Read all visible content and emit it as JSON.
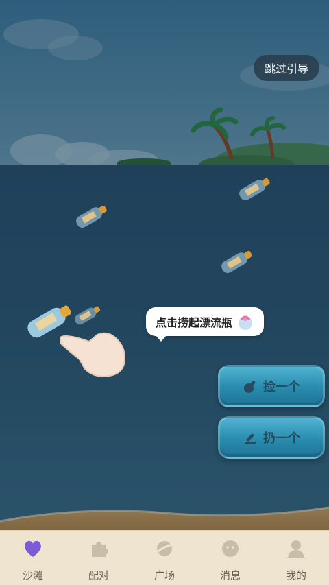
{
  "guide": {
    "skip_label": "跳过引导"
  },
  "tooltip": {
    "text": "点击捞起漂流瓶"
  },
  "actions": {
    "pick_label": "捡一个",
    "throw_label": "扔一个"
  },
  "tabs": [
    {
      "label": "沙滩",
      "icon": "heart-icon",
      "active": true
    },
    {
      "label": "配对",
      "icon": "puzzle-icon",
      "active": false
    },
    {
      "label": "广场",
      "icon": "planet-icon",
      "active": false
    },
    {
      "label": "消息",
      "icon": "chat-face-icon",
      "active": false
    },
    {
      "label": "我的",
      "icon": "user-icon",
      "active": false
    }
  ],
  "colors": {
    "accent": "#7b5cd6",
    "tab_bg": "#efe4cf",
    "button": "#2a9ec4"
  }
}
